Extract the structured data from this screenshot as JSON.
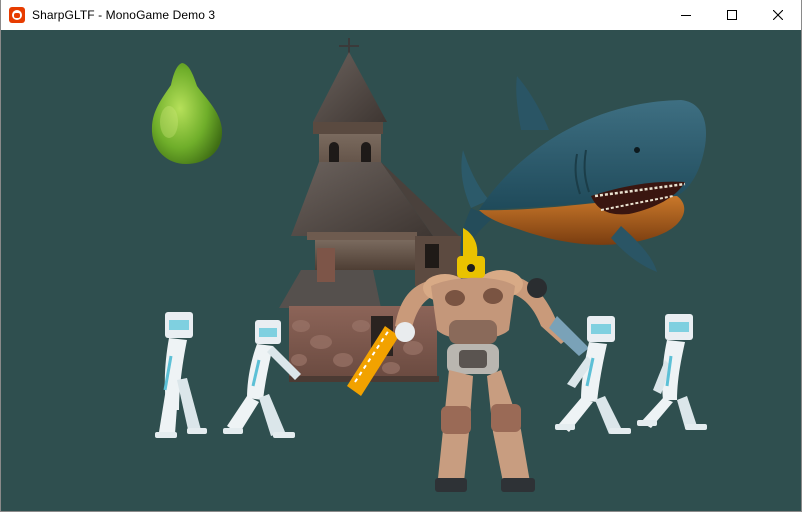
{
  "window": {
    "title": "SharpGLTF - MonoGame Demo 3",
    "app_icon": "monogame-logo-icon",
    "controls": [
      "minimize-icon",
      "maximize-icon",
      "close-icon"
    ],
    "accent_color": "#e73c00"
  },
  "scene": {
    "background_color": "#2f4f4f",
    "objects": [
      "pear",
      "haunted-house",
      "shark",
      "battle-robot",
      "walking-character",
      "walking-character",
      "walking-character",
      "walking-character"
    ]
  }
}
